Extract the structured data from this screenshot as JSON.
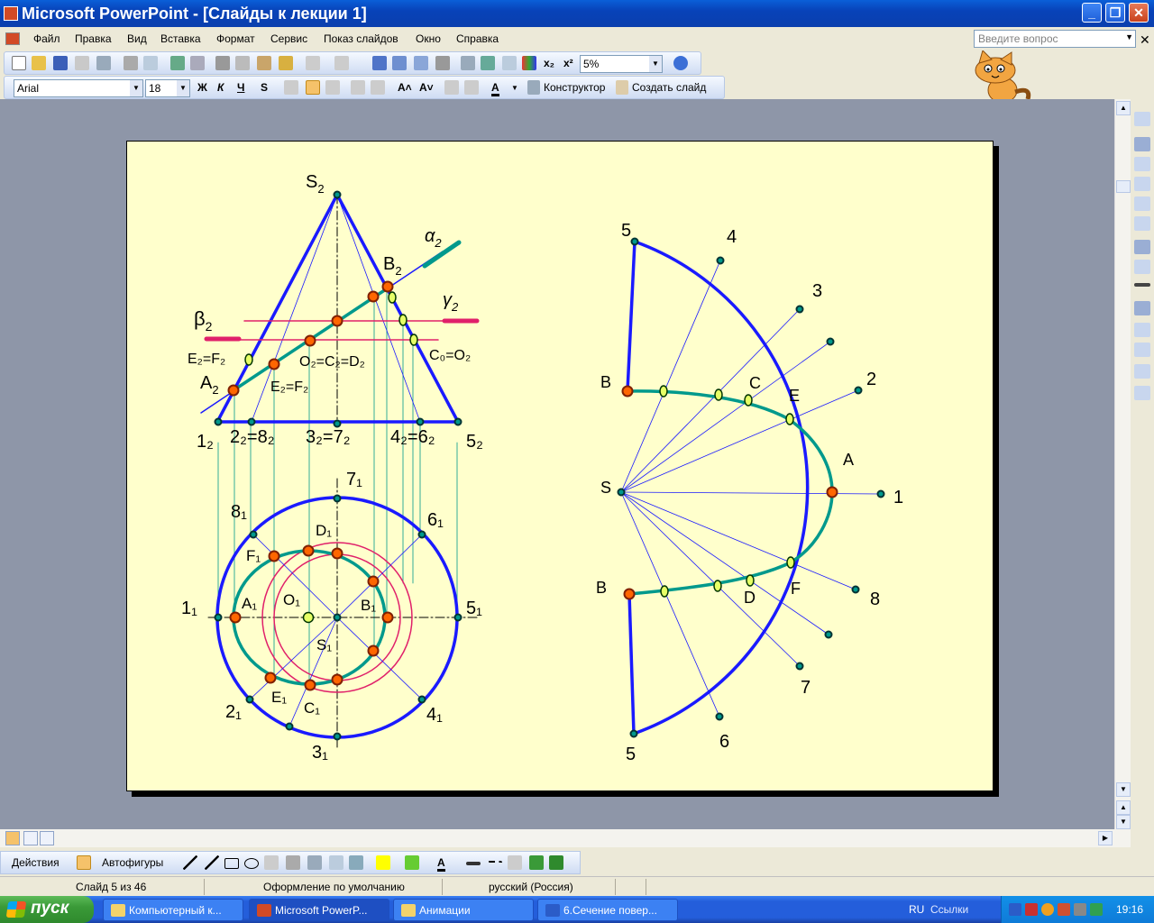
{
  "window": {
    "title": "Microsoft PowerPoint - [Слайды к лекции 1]",
    "min": "_",
    "max": "❐",
    "close": "✕"
  },
  "menu": {
    "items": [
      "Файл",
      "Правка",
      "Вид",
      "Вставка",
      "Формат",
      "Сервис",
      "Показ слайдов",
      "Окно",
      "Справка"
    ]
  },
  "help_box": {
    "placeholder": "Введите вопрос"
  },
  "standard_toolbar": {
    "zoom": "5%"
  },
  "format_toolbar": {
    "font": "Arial",
    "size": "18",
    "bold": "Ж",
    "italic": "К",
    "underline": "Ч",
    "shadow": "S",
    "designer": "Конструктор",
    "new_slide": "Создать слайд"
  },
  "drawing_toolbar": {
    "actions": "Действия",
    "autoshapes": "Автофигуры"
  },
  "status": {
    "slide": "Слайд 5 из 46",
    "design": "Оформление по умолчанию",
    "language": "русский (Россия)"
  },
  "taskbar": {
    "start": "пуск",
    "tasks": [
      "Компьютерный к...",
      "Microsoft PowerP...",
      "Анимации",
      "6.Сечение повер..."
    ],
    "lang": "RU",
    "links": "Ссылки",
    "clock": "19:16"
  },
  "slide": {
    "labels_left": {
      "S2": "S",
      "S2_sub": "2",
      "alpha2": "α",
      "alpha2_sub": "2",
      "B2": "B",
      "B2_sub": "2",
      "gamma2": "γ",
      "gamma2_sub": "2",
      "beta2": "β",
      "beta2_sub": "2",
      "EF2_top": "E₂=F₂",
      "O2CD": "O₂=C₂=D₂",
      "C0O2": "C₀=O₂",
      "A2": "A",
      "A2_sub": "2",
      "EF2_mid": "E₂=F₂",
      "p12": "1₂",
      "p28": "2₂=8₂",
      "p37": "3₂=7₂",
      "p46": "4₂=6₂",
      "p52": "5₂",
      "p71": "7₁",
      "p81": "8₁",
      "p61": "6₁",
      "D1": "D₁",
      "F1": "F₁",
      "O1": "O₁",
      "A1": "A₁",
      "B1": "B₁",
      "p11": "1₁",
      "p51": "5₁",
      "S1": "S₁",
      "E1": "E₁",
      "C1": "C₁",
      "p21": "2₁",
      "p41": "4₁",
      "p31": "3₁"
    },
    "labels_right": {
      "n5top": "5",
      "n4": "4",
      "n3": "3",
      "n2": "2",
      "n1": "1",
      "n8": "8",
      "n7": "7",
      "n6": "6",
      "n5bot": "5",
      "B_top": "B",
      "C": "C",
      "E": "E",
      "A": "A",
      "S": "S",
      "B_bot": "B",
      "D": "D",
      "F": "F"
    },
    "colors": {
      "outline": "#1a1aff",
      "curve": "#00998c",
      "plane": "#e0206a",
      "point": "#ff6600",
      "bg": "#ffffcc"
    }
  }
}
